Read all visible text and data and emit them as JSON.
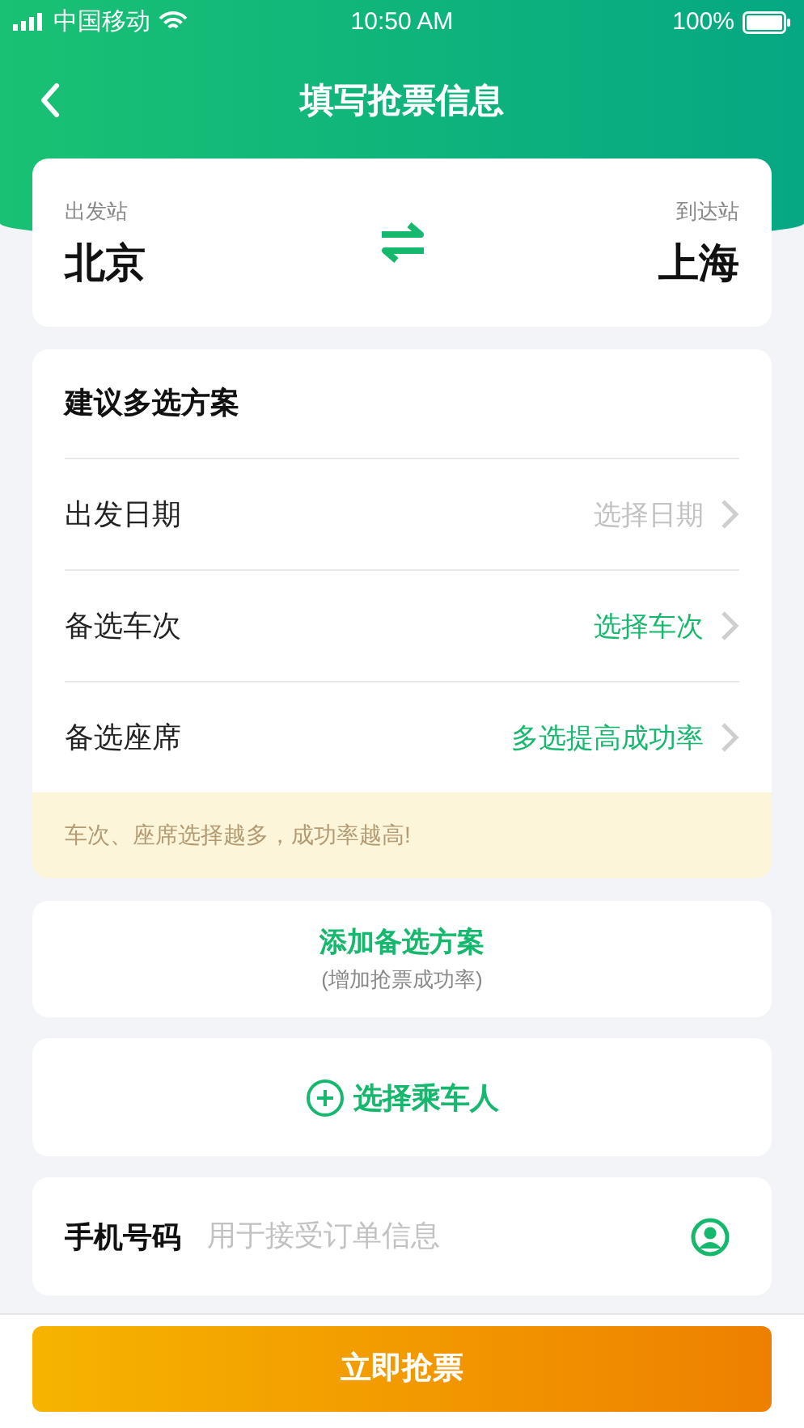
{
  "status_bar": {
    "carrier": "中国移动",
    "time": "10:50 AM",
    "battery": "100%"
  },
  "nav": {
    "title": "填写抢票信息"
  },
  "route": {
    "from_label": "出发站",
    "from": "北京",
    "to_label": "到达站",
    "to": "上海"
  },
  "plan": {
    "title": "建议多选方案",
    "options": [
      {
        "label": "出发日期",
        "value": "选择日期",
        "kind": "placeholder"
      },
      {
        "label": "备选车次",
        "value": "选择车次",
        "kind": "action"
      },
      {
        "label": "备选座席",
        "value": "多选提高成功率",
        "kind": "action"
      }
    ],
    "tip": "车次、座席选择越多，成功率越高!"
  },
  "add_plan": {
    "title": "添加备选方案",
    "subtitle": "(增加抢票成功率)"
  },
  "passenger": {
    "label": "选择乘车人"
  },
  "phone": {
    "label": "手机号码",
    "placeholder": "用于接受订单信息"
  },
  "submit": "立即抢票"
}
